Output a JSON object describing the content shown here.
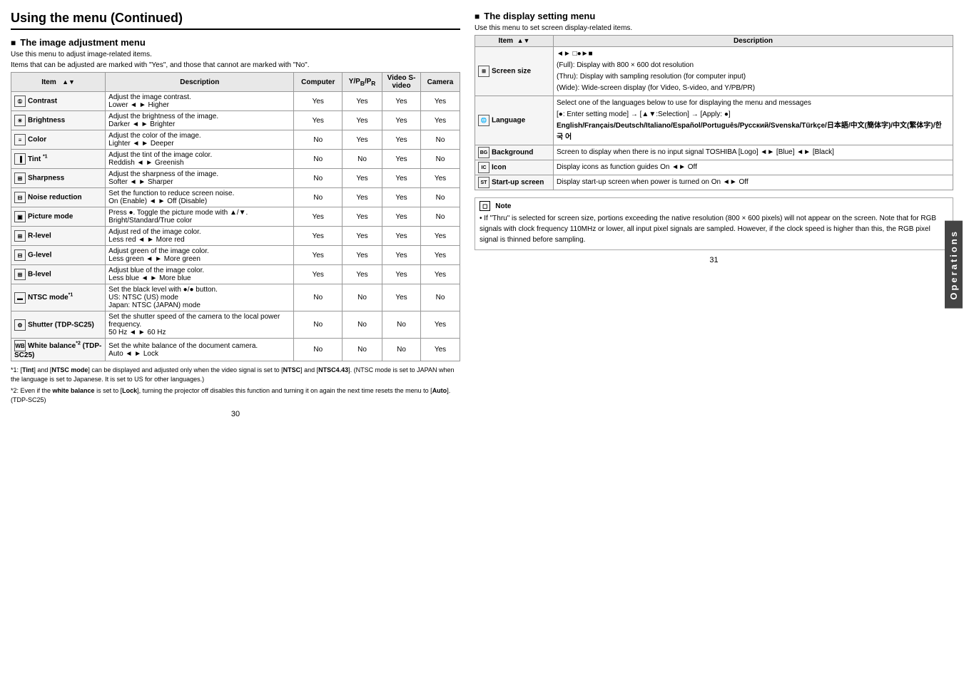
{
  "page": {
    "title": "Using the menu (Continued)",
    "left_page_num": "30",
    "right_page_num": "31",
    "sidebar_label": "Operations"
  },
  "left_section": {
    "title": "The image adjustment menu",
    "desc1": "Use this menu to adjust image-related items.",
    "desc2": "Items that can be adjusted are marked with  \"Yes\", and those that cannot are marked with \"No\".",
    "table_headers": {
      "item": "Item",
      "description": "Description",
      "computer": "Computer",
      "ypbpr": "Y/PB/PR",
      "svideo": "Video S-video",
      "camera": "Camera"
    },
    "rows": [
      {
        "icon": "①",
        "item": "Contrast",
        "desc": "Adjust the image contrast.\nLower ◄ ► Higher",
        "computer": "Yes",
        "ypbpr": "Yes",
        "svideo": "Yes",
        "camera": "Yes"
      },
      {
        "icon": "☀",
        "item": "Brightness",
        "desc": "Adjust the brightness of the image.\nDarker ◄ ► Brighter",
        "computer": "Yes",
        "ypbpr": "Yes",
        "svideo": "Yes",
        "camera": "Yes"
      },
      {
        "icon": "≡",
        "item": "Color",
        "desc": "Adjust the color of the image.\nLighter ◄ ► Deeper",
        "computer": "No",
        "ypbpr": "Yes",
        "svideo": "Yes",
        "camera": "No"
      },
      {
        "icon": "▐",
        "item": "Tint *1",
        "desc": "Adjust the tint of the image color.\nReddish ◄ ► Greenish",
        "computer": "No",
        "ypbpr": "No",
        "svideo": "Yes",
        "camera": "No"
      },
      {
        "icon": "⊞",
        "item": "Sharpness",
        "desc": "Adjust the sharpness of the image.\nSofter ◄ ► Sharper",
        "computer": "No",
        "ypbpr": "Yes",
        "svideo": "Yes",
        "camera": "Yes"
      },
      {
        "icon": "⊟",
        "item": "Noise reduction",
        "desc": "Set the function to reduce screen noise.\nOn (Enable) ◄ ► Off (Disable)",
        "computer": "No",
        "ypbpr": "Yes",
        "svideo": "Yes",
        "camera": "No"
      },
      {
        "icon": "▣",
        "item": "Picture mode",
        "desc": "Press ●. Toggle the picture mode with ▲/▼.\nBright/Standard/True color",
        "computer": "Yes",
        "ypbpr": "Yes",
        "svideo": "Yes",
        "camera": "No"
      },
      {
        "icon": "⊞",
        "item": "R-level",
        "desc": "Adjust red of the image color.\nLess red ◄ ► More red",
        "computer": "Yes",
        "ypbpr": "Yes",
        "svideo": "Yes",
        "camera": "Yes"
      },
      {
        "icon": "⊟",
        "item": "G-level",
        "desc": "Adjust green of the image color.\nLess green ◄ ► More green",
        "computer": "Yes",
        "ypbpr": "Yes",
        "svideo": "Yes",
        "camera": "Yes"
      },
      {
        "icon": "⊞",
        "item": "B-level",
        "desc": "Adjust blue of the image color.\nLess blue ◄ ► More blue",
        "computer": "Yes",
        "ypbpr": "Yes",
        "svideo": "Yes",
        "camera": "Yes"
      },
      {
        "icon": "▬",
        "item": "NTSC mode*1",
        "desc": "Set the black level with ●/● button.\nUS:      NTSC (US) mode\nJapan:  NTSC (JAPAN) mode",
        "computer": "No",
        "ypbpr": "No",
        "svideo": "Yes",
        "camera": "No"
      },
      {
        "icon": "⚙",
        "item": "Shutter (TDP-SC25)",
        "desc": "Set the shutter speed of the camera to the local power frequency.\n50 Hz ◄ ► 60 Hz",
        "computer": "No",
        "ypbpr": "No",
        "svideo": "No",
        "camera": "Yes"
      },
      {
        "icon": "WB",
        "item": "White balance*2 (TDP-SC25)",
        "desc": "Set the white balance of the document camera.\nAuto ◄ ► Lock",
        "computer": "No",
        "ypbpr": "No",
        "svideo": "No",
        "camera": "Yes"
      }
    ],
    "footnotes": [
      "*1: [Tint] and [NTSC mode] can be displayed and adjusted only when the video signal is set to [NTSC] and [NTSC4.43]. (NTSC mode is set to JAPAN when the language is set to Japanese. It is set to US for other languages.)",
      "*2: Even if the white balance is set to [Lock], turning  the projector off disables this function and turning it on again the next time resets the menu to [Auto]. (TDP-SC25)"
    ]
  },
  "right_section": {
    "title": "The display setting menu",
    "desc1": "Use this menu to set screen display-related items.",
    "table_headers": {
      "item": "Item",
      "description": "Description"
    },
    "rows": [
      {
        "icon": "⊞",
        "item": "Screen size",
        "desc_lines": [
          "◄► □●►■",
          "(Full):  Display with 800 × 600 dot resolution",
          "(Thru): Display with sampling resolution (for computer input)",
          "(Wide):  Wide-screen display (for Video, S-video, and Y/PB/PR)"
        ]
      },
      {
        "icon": "🌐",
        "item": "Language",
        "desc_lines": [
          "Select one of the languages below to use for displaying the menu and messages",
          "[●: Enter setting mode] → [▲▼:Selection] → [Apply: ●]",
          "English/Français/Deutsch/Italiano/Español/Português/Русский/Svenska/Türkçe/日本語/中文(簡体字)/中文(繁体字)/한 국 어"
        ]
      },
      {
        "icon": "BG",
        "item": "Background",
        "desc_lines": [
          "Screen to display when there is no input signal TOSHIBA [Logo] ◄► [Blue] ◄► [Black]"
        ]
      },
      {
        "icon": "IC",
        "item": "Icon",
        "desc_lines": [
          "Display icons as function guides         On ◄► Off"
        ]
      },
      {
        "icon": "ST",
        "item": "Start-up screen",
        "desc_lines": [
          "Display start-up screen when power is turned on   On ◄► Off"
        ]
      }
    ],
    "note": {
      "title": "Note",
      "content": "• If \"Thru\" is selected for screen size, portions exceeding the native resolution (800 × 600 pixels) will not appear on the screen. Note that for RGB signals with clock frequency 110MHz or lower, all input pixel signals are sampled. However, if the clock speed is higher than this, the RGB pixel signal is thinned before sampling."
    }
  }
}
